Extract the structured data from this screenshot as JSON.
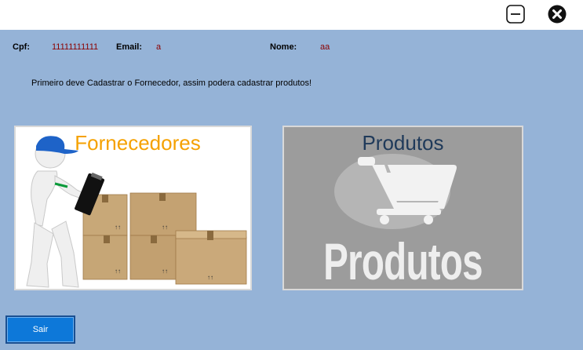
{
  "window": {
    "minimize_icon": "minimize-icon",
    "close_icon": "close-circle-icon"
  },
  "user": {
    "cpf_label": "Cpf:",
    "cpf_value": "11111111111",
    "email_label": "Email:",
    "email_value": "a",
    "nome_label": "Nome:",
    "nome_value": "aa"
  },
  "message": "Primeiro deve Cadastrar o Fornecedor, assim podera cadastrar produtos!",
  "cards": {
    "fornecedores": {
      "title": "Fornecedores"
    },
    "produtos": {
      "title": "Produtos",
      "image_text": "Produtos"
    }
  },
  "actions": {
    "sair_label": "Sair"
  },
  "colors": {
    "background": "#95b3d7",
    "value_text": "#8b0000",
    "fornecedores_title": "#f5a100",
    "produtos_title": "#1f3a5a",
    "button_bg": "#0d78d9"
  }
}
